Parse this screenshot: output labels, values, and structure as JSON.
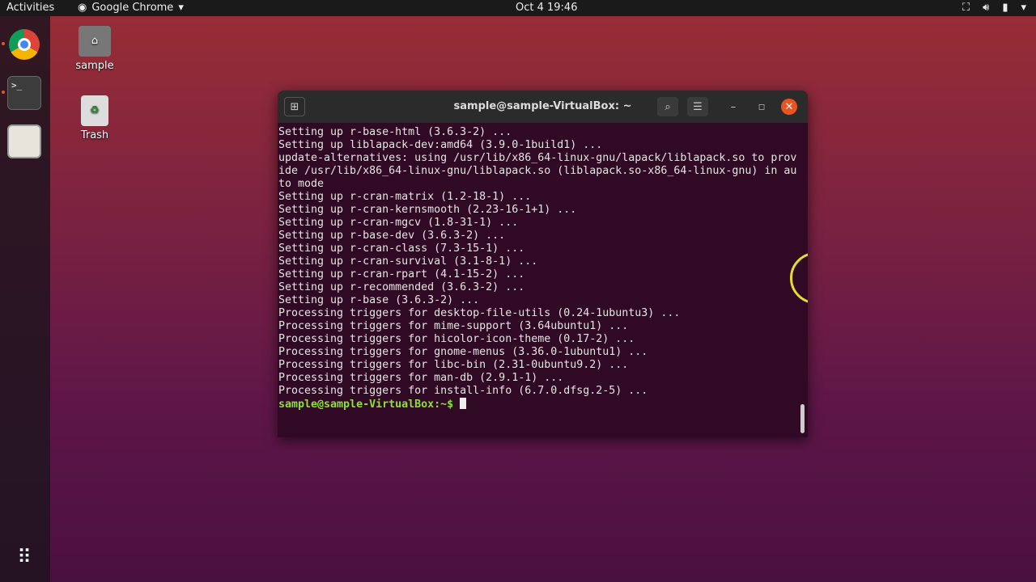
{
  "topbar": {
    "activities": "Activities",
    "app": "Google Chrome",
    "clock": "Oct 4  19:46",
    "tray_icons": [
      "network-icon",
      "volume-icon",
      "battery-icon",
      "menu-arrow-icon"
    ]
  },
  "dock": {
    "items": [
      "chrome-icon",
      "terminal-icon",
      "files-icon",
      "show-apps-icon"
    ]
  },
  "desktop": {
    "icons": [
      {
        "label": "sample"
      },
      {
        "label": "Trash"
      }
    ]
  },
  "terminal": {
    "title": "sample@sample-VirtualBox: ~",
    "lines": [
      "Setting up r-base-html (3.6.3-2) ...",
      "Setting up liblapack-dev:amd64 (3.9.0-1build1) ...",
      "update-alternatives: using /usr/lib/x86_64-linux-gnu/lapack/liblapack.so to prov",
      "ide /usr/lib/x86_64-linux-gnu/liblapack.so (liblapack.so-x86_64-linux-gnu) in au",
      "to mode",
      "Setting up r-cran-matrix (1.2-18-1) ...",
      "Setting up r-cran-kernsmooth (2.23-16-1+1) ...",
      "Setting up r-cran-mgcv (1.8-31-1) ...",
      "Setting up r-base-dev (3.6.3-2) ...",
      "Setting up r-cran-class (7.3-15-1) ...",
      "Setting up r-cran-survival (3.1-8-1) ...",
      "Setting up r-cran-rpart (4.1-15-2) ...",
      "Setting up r-recommended (3.6.3-2) ...",
      "Setting up r-base (3.6.3-2) ...",
      "Processing triggers for desktop-file-utils (0.24-1ubuntu3) ...",
      "Processing triggers for mime-support (3.64ubuntu1) ...",
      "Processing triggers for hicolor-icon-theme (0.17-2) ...",
      "Processing triggers for gnome-menus (3.36.0-1ubuntu1) ...",
      "Processing triggers for libc-bin (2.31-0ubuntu9.2) ...",
      "Processing triggers for man-db (2.9.1-1) ...",
      "Processing triggers for install-info (6.7.0.dfsg.2-5) ..."
    ],
    "prompt": "sample@sample-VirtualBox:~$ "
  }
}
